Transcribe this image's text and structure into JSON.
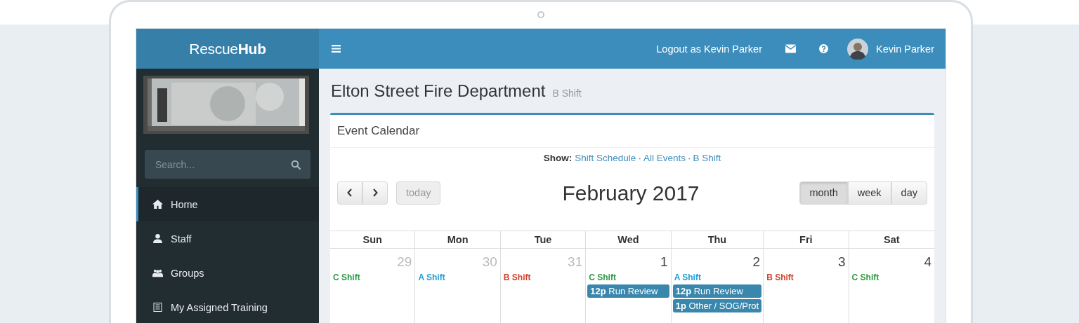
{
  "brand": {
    "light": "Rescue",
    "bold": "Hub"
  },
  "topbar": {
    "logout": "Logout as Kevin Parker",
    "user": "Kevin Parker"
  },
  "sidebar": {
    "search": {
      "placeholder": "Search..."
    },
    "items": [
      {
        "label": "Home",
        "selected": true
      },
      {
        "label": "Staff",
        "selected": false
      },
      {
        "label": "Groups",
        "selected": false
      },
      {
        "label": "My Assigned Training",
        "selected": false
      }
    ]
  },
  "page": {
    "title": "Elton Street Fire Department",
    "subtitle": "B Shift"
  },
  "panel": {
    "title": "Event Calendar",
    "show_label": "Show:",
    "filters": [
      "Shift Schedule",
      "All Events",
      "B Shift"
    ],
    "separator": "·"
  },
  "calendar": {
    "today": "today",
    "month": "February 2017",
    "views": [
      {
        "label": "month",
        "selected": true
      },
      {
        "label": "week",
        "selected": false
      },
      {
        "label": "day",
        "selected": false
      }
    ],
    "weekdays": [
      "Sun",
      "Mon",
      "Tue",
      "Wed",
      "Thu",
      "Fri",
      "Sat"
    ],
    "days": [
      {
        "number": "29",
        "other_month": true,
        "events": [
          {
            "kind": "shift",
            "text": "C Shift",
            "color": "#2e9b45"
          }
        ]
      },
      {
        "number": "30",
        "other_month": true,
        "events": [
          {
            "kind": "shift",
            "text": "A Shift",
            "color": "#1f9fd6"
          }
        ]
      },
      {
        "number": "31",
        "other_month": true,
        "events": [
          {
            "kind": "shift",
            "text": "B Shift",
            "color": "#d23f2c"
          }
        ]
      },
      {
        "number": "1",
        "other_month": false,
        "events": [
          {
            "kind": "shift",
            "text": "C Shift",
            "color": "#2e9b45"
          },
          {
            "kind": "event",
            "text": "**12p** Run Review"
          }
        ]
      },
      {
        "number": "2",
        "other_month": false,
        "events": [
          {
            "kind": "shift",
            "text": "A Shift",
            "color": "#1f9fd6"
          },
          {
            "kind": "event",
            "text": "**12p** Run Review"
          },
          {
            "kind": "event",
            "text": "**1p** Other / SOG/Prot"
          }
        ]
      },
      {
        "number": "3",
        "other_month": false,
        "events": [
          {
            "kind": "shift",
            "text": "B Shift",
            "color": "#d23f2c"
          }
        ]
      },
      {
        "number": "4",
        "other_month": false,
        "events": [
          {
            "kind": "shift",
            "text": "C Shift",
            "color": "#2e9b45"
          }
        ]
      }
    ]
  }
}
